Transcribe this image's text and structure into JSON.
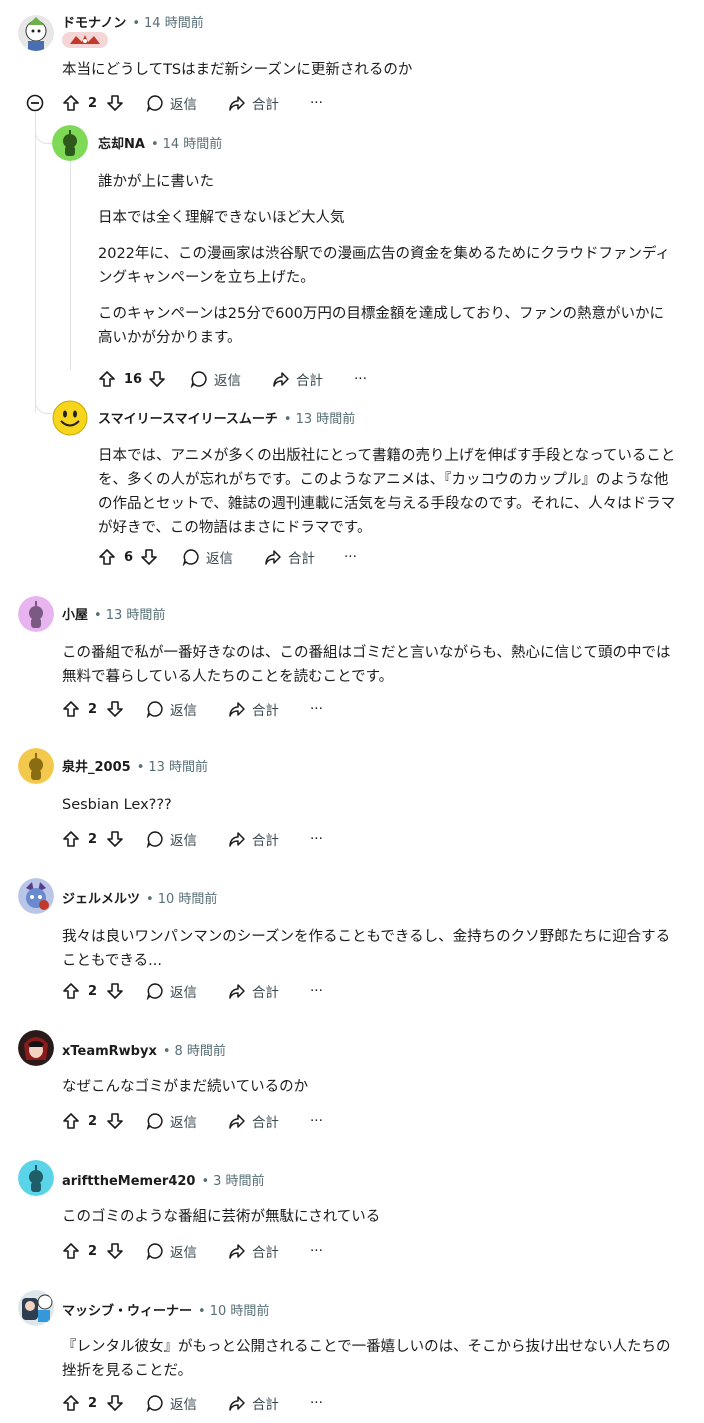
{
  "comments": [
    {
      "author": "ドモナノン",
      "time": "14 時間前",
      "body": [
        "本当にどうしてTSはまだ新シーズンに更新されるのか"
      ],
      "votes": "2",
      "reply": "返信",
      "share": "合計"
    },
    {
      "author": "忘却NA",
      "time": "14 時間前",
      "body": [
        "誰かが上に書いた",
        "日本では全く理解できないほど大人気",
        "2022年に、この漫画家は渋谷駅での漫画広告の資金を集めるためにクラウドファンディングキャンペーンを立ち上げた。",
        "このキャンペーンは25分で600万円の目標金額を達成しており、ファンの熱意がいかに高いかが分かります。"
      ],
      "votes": "16",
      "reply": "返信",
      "share": "合計"
    },
    {
      "author": "スマイリースマイリースムーチ",
      "time": "13 時間前",
      "body": [
        "日本では、アニメが多くの出版社にとって書籍の売り上げを伸ばす手段となっていることを、多くの人が忘れがちです。このようなアニメは、『カッコウのカップル』のような他の作品とセットで、雑誌の週刊連載に活気を与える手段なのです。それに、人々はドラマが好きで、この物語はまさにドラマです。"
      ],
      "votes": "6",
      "reply": "返信",
      "share": "合計"
    },
    {
      "author": "小屋",
      "time": "13 時間前",
      "body": [
        "この番組で私が一番好きなのは、この番組はゴミだと言いながらも、熱心に信じて頭の中では無料で暮らしている人たちのことを読むことです。"
      ],
      "votes": "2",
      "reply": "返信",
      "share": "合計"
    },
    {
      "author": "泉井_2005",
      "time": "13 時間前",
      "body": [
        "Sesbian Lex???"
      ],
      "votes": "2",
      "reply": "返信",
      "share": "合計"
    },
    {
      "author": "ジェルメルツ",
      "time": "10 時間前",
      "body": [
        "我々は良いワンパンマンのシーズンを作ることもできるし、金持ちのクソ野郎たちに迎合することもできる..."
      ],
      "votes": "2",
      "reply": "返信",
      "share": "合計"
    },
    {
      "author": "xTeamRwbyx",
      "time": "8 時間前",
      "body": [
        "なぜこんなゴミがまだ続いているのか"
      ],
      "votes": "2",
      "reply": "返信",
      "share": "合計"
    },
    {
      "author": "arifttheMemer420",
      "time": "3 時間前",
      "body": [
        "このゴミのような番組に芸術が無駄にされている"
      ],
      "votes": "2",
      "reply": "返信",
      "share": "合計"
    },
    {
      "author": "マッシブ・ウィーナー",
      "time": "10 時間前",
      "body": [
        "『レンタル彼女』がもっと公開されることで一番嬉しいのは、そこから抜け出せない人たちの挫折を見ることだ。"
      ],
      "votes": "2",
      "reply": "返信",
      "share": "合計"
    }
  ],
  "more_label": "···",
  "colors": {
    "accent": "#576f76",
    "avatar_green": "#7ed957",
    "avatar_pink": "#e8b4f0",
    "avatar_yellow": "#f2c94c",
    "avatar_cyan": "#5bd3e8"
  }
}
